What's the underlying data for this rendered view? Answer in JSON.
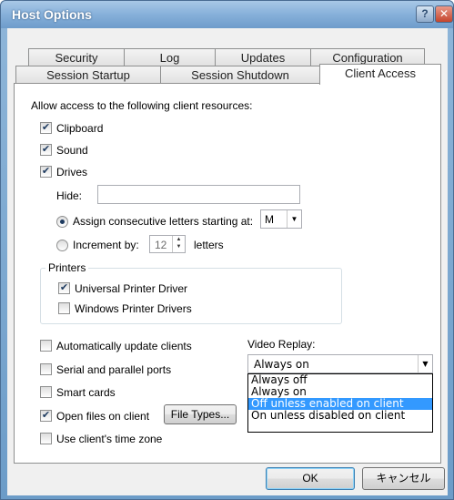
{
  "window": {
    "title": "Host Options",
    "help_glyph": "?",
    "close_glyph": "✕"
  },
  "tabs": {
    "row1": [
      "Security",
      "Log",
      "Updates",
      "Configuration"
    ],
    "row2": [
      "Session Startup",
      "Session Shutdown",
      "Client Access"
    ],
    "active": "Client Access"
  },
  "content": {
    "intro": "Allow access to the following client resources:",
    "clipboard": {
      "label": "Clipboard",
      "checked": true
    },
    "sound": {
      "label": "Sound",
      "checked": true
    },
    "drives": {
      "label": "Drives",
      "checked": true
    },
    "hide_label": "Hide:",
    "hide_value": "",
    "assign_label": "Assign consecutive letters starting at:",
    "assign_selected": true,
    "drive_letter": "M",
    "increment_label": "Increment by:",
    "increment_value": "12",
    "letters_label": "letters",
    "printers": {
      "group_title": "Printers",
      "universal": {
        "label": "Universal Printer Driver",
        "checked": true
      },
      "windows": {
        "label": "Windows Printer Drivers",
        "checked": false
      }
    },
    "auto_update": {
      "label": "Automatically update clients",
      "checked": false
    },
    "serial_parallel": {
      "label": "Serial and parallel ports",
      "checked": false
    },
    "smart_cards": {
      "label": "Smart cards",
      "checked": false
    },
    "open_files": {
      "label": "Open files on client",
      "checked": true
    },
    "file_types_button": "File Types...",
    "time_zone": {
      "label": "Use client's time zone",
      "checked": false
    },
    "video_replay": {
      "label": "Video Replay:",
      "value": "Always on",
      "options": [
        "Always off",
        "Always on",
        "Off unless enabled on client",
        "On unless disabled on client"
      ],
      "highlighted": "Off unless enabled on client"
    }
  },
  "buttons": {
    "ok": "OK",
    "cancel": "キャンセル"
  },
  "glyphs": {
    "check": "✔",
    "down_arrow": "▼",
    "up_small": "▲",
    "down_small": "▼"
  }
}
